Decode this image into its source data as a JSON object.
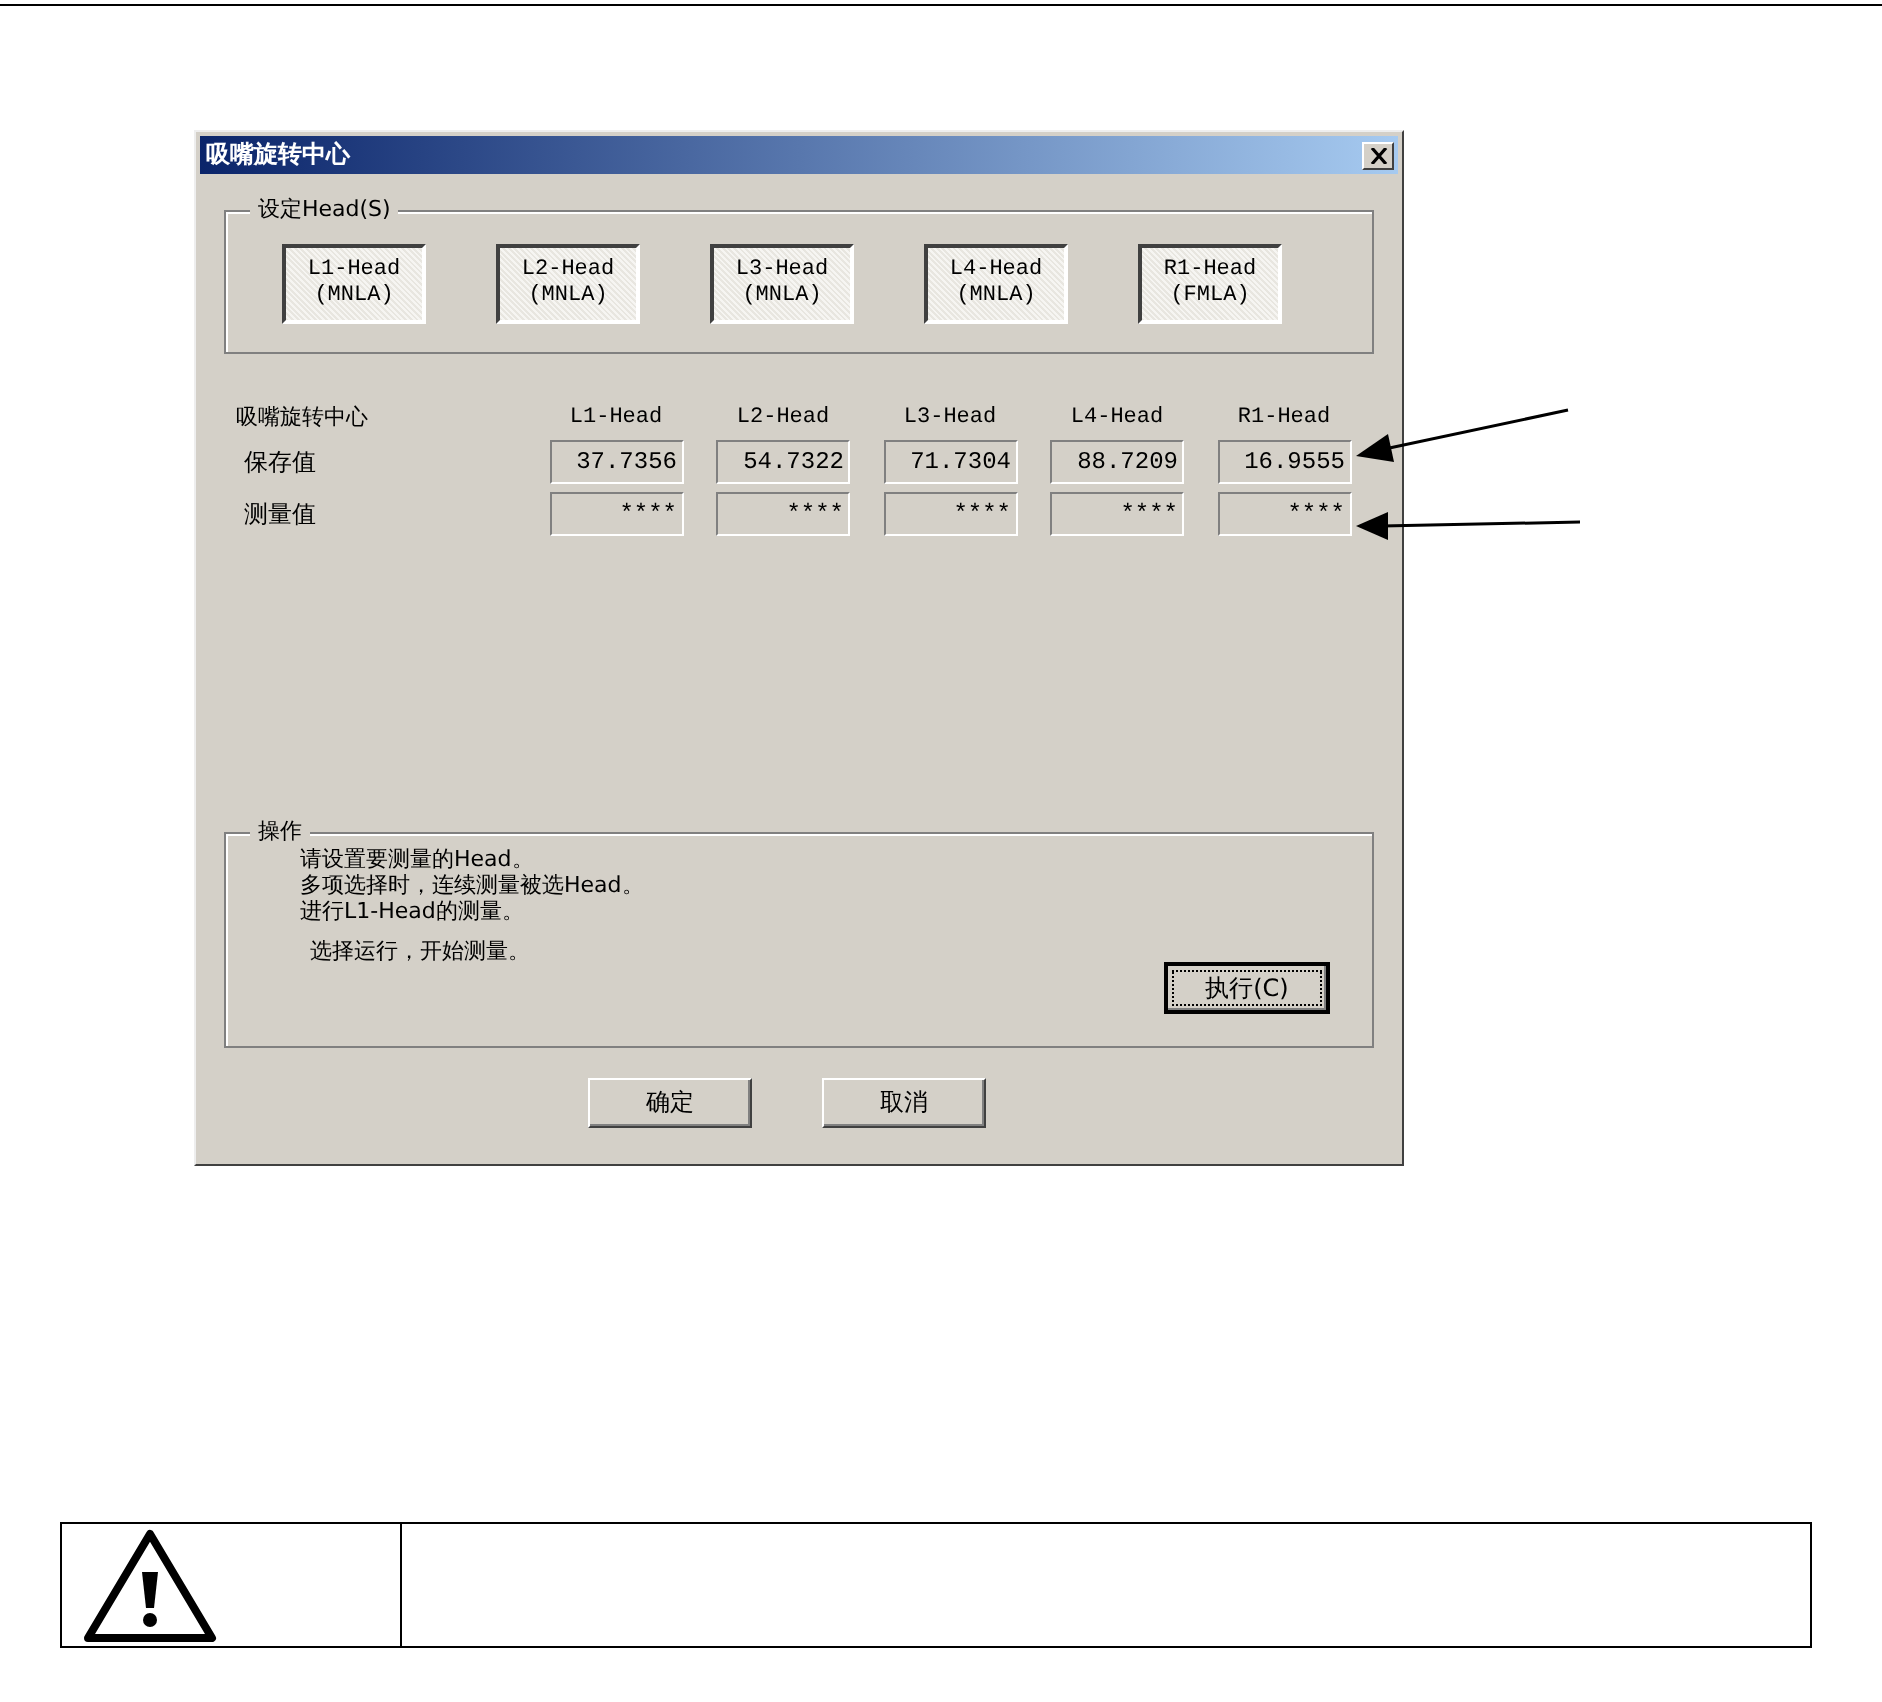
{
  "dialog": {
    "title": "吸嘴旋转中心",
    "head_group": {
      "label": "设定Head(S)",
      "buttons": [
        {
          "name": "L1-Head",
          "type": "(MNLA)",
          "selected": true
        },
        {
          "name": "L2-Head",
          "type": "(MNLA)",
          "selected": true
        },
        {
          "name": "L3-Head",
          "type": "(MNLA)",
          "selected": true
        },
        {
          "name": "L4-Head",
          "type": "(MNLA)",
          "selected": true
        },
        {
          "name": "R1-Head",
          "type": "(FMLA)",
          "selected": true
        }
      ]
    },
    "table": {
      "title": "吸嘴旋转中心",
      "columns": [
        "L1-Head",
        "L2-Head",
        "L3-Head",
        "L4-Head",
        "R1-Head"
      ],
      "rows": [
        {
          "label": "保存值",
          "values": [
            "37.7356",
            "54.7322",
            "71.7304",
            "88.7209",
            "16.9555"
          ]
        },
        {
          "label": "测量值",
          "values": [
            "****",
            "****",
            "****",
            "****",
            "****"
          ]
        }
      ]
    },
    "operation": {
      "label": "操作",
      "lines": [
        "请设置要测量的Head。",
        "多项选择时，连续测量被选Head。",
        "进行L1-Head的测量。"
      ],
      "instruction": "选择运行，开始测量。",
      "run_button": "执行(C)"
    },
    "buttons": [
      "确定",
      "取消"
    ]
  }
}
